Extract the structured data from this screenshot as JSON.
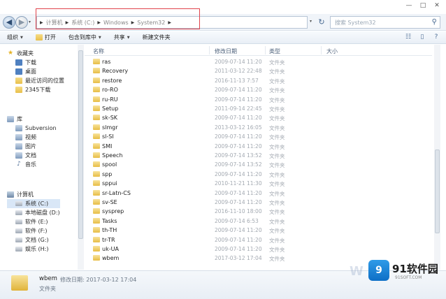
{
  "window": {
    "controls": [
      "—",
      "□",
      "✕"
    ]
  },
  "nav": {
    "back_icon": "◀",
    "forward_icon": "▶",
    "dropdown_icon": "▾",
    "refresh_icon": "↻"
  },
  "address": {
    "crumbs": [
      "计算机",
      "系统 (C:)",
      "Windows",
      "System32"
    ],
    "separator": "▶"
  },
  "search": {
    "placeholder": "搜索 System32",
    "icon": "search-icon"
  },
  "toolbar": {
    "organize": "组织",
    "open": "打开",
    "include_library": "包含到库中",
    "share": "共享",
    "new_folder": "新建文件夹"
  },
  "sidebar": {
    "favorites": {
      "label": "收藏夹",
      "items": [
        "下载",
        "桌面",
        "最近访问的位置",
        "2345下载"
      ]
    },
    "libraries": {
      "label": "库",
      "items": [
        "Subversion",
        "视频",
        "图片",
        "文档",
        "音乐"
      ]
    },
    "computer": {
      "label": "计算机",
      "items": [
        "系统 (C:)",
        "本地磁盘 (D:)",
        "软件 (E:)",
        "软件 (F:)",
        "文档 (G:)",
        "娱乐 (H:)"
      ]
    }
  },
  "columns": {
    "name": "名称",
    "date": "修改日期",
    "type": "类型",
    "size": "大小"
  },
  "files": [
    {
      "name": "ras",
      "date": "2009-07-14 11:20",
      "type": "文件夹"
    },
    {
      "name": "Recovery",
      "date": "2011-03-12 22:48",
      "type": "文件夹"
    },
    {
      "name": "restore",
      "date": "2016-11-13 7:57",
      "type": "文件夹"
    },
    {
      "name": "ro-RO",
      "date": "2009-07-14 11:20",
      "type": "文件夹"
    },
    {
      "name": "ru-RU",
      "date": "2009-07-14 11:20",
      "type": "文件夹"
    },
    {
      "name": "Setup",
      "date": "2011-09-14 22:45",
      "type": "文件夹"
    },
    {
      "name": "sk-SK",
      "date": "2009-07-14 11:20",
      "type": "文件夹"
    },
    {
      "name": "slmgr",
      "date": "2013-03-12 16:05",
      "type": "文件夹"
    },
    {
      "name": "sl-SI",
      "date": "2009-07-14 11:20",
      "type": "文件夹"
    },
    {
      "name": "SMI",
      "date": "2009-07-14 11:20",
      "type": "文件夹"
    },
    {
      "name": "Speech",
      "date": "2009-07-14 13:52",
      "type": "文件夹"
    },
    {
      "name": "spool",
      "date": "2009-07-14 13:52",
      "type": "文件夹"
    },
    {
      "name": "spp",
      "date": "2009-07-14 11:20",
      "type": "文件夹"
    },
    {
      "name": "sppui",
      "date": "2010-11-21 11:30",
      "type": "文件夹"
    },
    {
      "name": "sr-Latn-CS",
      "date": "2009-07-14 11:20",
      "type": "文件夹"
    },
    {
      "name": "sv-SE",
      "date": "2009-07-14 11:20",
      "type": "文件夹"
    },
    {
      "name": "sysprep",
      "date": "2016-11-10 18:00",
      "type": "文件夹"
    },
    {
      "name": "Tasks",
      "date": "2009-07-14 6:53",
      "type": "文件夹"
    },
    {
      "name": "th-TH",
      "date": "2009-07-14 11:20",
      "type": "文件夹"
    },
    {
      "name": "tr-TR",
      "date": "2009-07-14 11:20",
      "type": "文件夹"
    },
    {
      "name": "uk-UA",
      "date": "2009-07-14 11:20",
      "type": "文件夹"
    },
    {
      "name": "wbem",
      "date": "2017-03-12 17:04",
      "type": "文件夹"
    }
  ],
  "details": {
    "name": "wbem",
    "modified": "修改日期: 2017-03-12 17:04",
    "type": "文件夹"
  },
  "watermark": {
    "logo": "9",
    "brand": "91软件园",
    "url": "91SOFT.COM",
    "letter": "W"
  },
  "colors": {
    "highlight_border": "#e0434b",
    "accent": "#4a6b92"
  }
}
